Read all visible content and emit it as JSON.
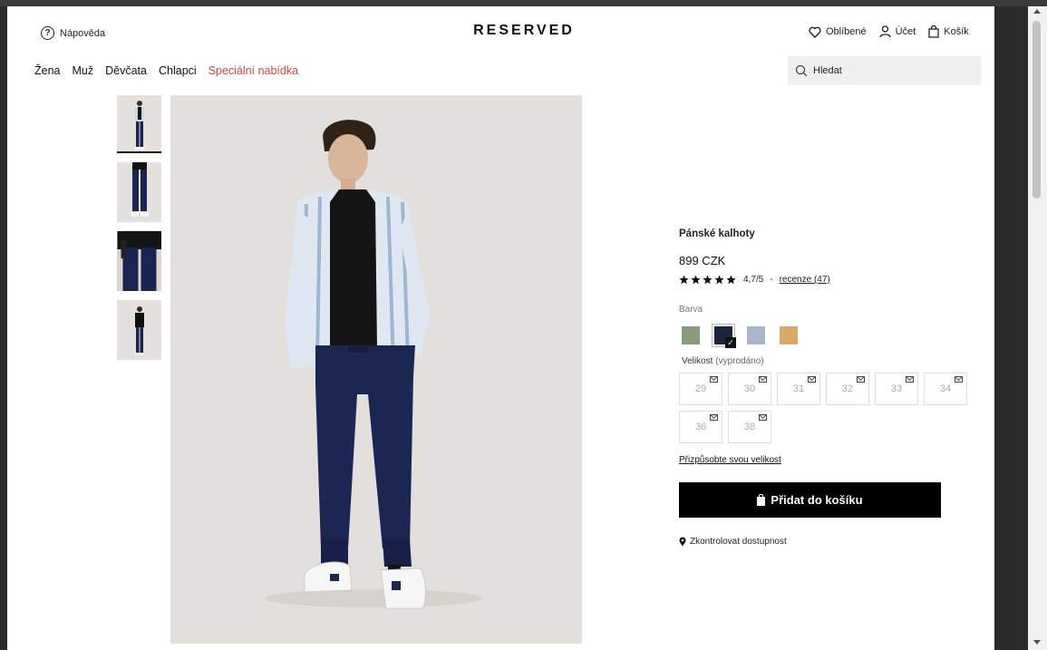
{
  "header": {
    "help_label": "Nápověda",
    "logo": "RESERVED",
    "favorites_label": "Oblíbené",
    "account_label": "Účet",
    "cart_label": "Košík"
  },
  "nav": {
    "items": [
      "Žena",
      "Muž",
      "Děvčata",
      "Chlapci"
    ],
    "special": "Speciální nabídka"
  },
  "search": {
    "placeholder": "Hledat"
  },
  "product": {
    "name": "Pánské kalhoty",
    "price": "899 CZK",
    "rating": "4,7/5",
    "separator": "-",
    "reviews_link": "recenze (47)",
    "color_label": "Barva",
    "colors": [
      "#8a9a7f",
      "#1c2440",
      "#a9b7c9",
      "#d9a96a"
    ],
    "selected_color_index": 1,
    "size_label": "Velikost",
    "size_note": "(vyprodáno)",
    "sizes": [
      "29",
      "30",
      "31",
      "32",
      "33",
      "34",
      "36",
      "38"
    ],
    "fit_link": "Přizpůsobte svou velikost",
    "add_to_cart": "Přidat do košíku",
    "availability": "Zkontrolovat dostupnost"
  }
}
